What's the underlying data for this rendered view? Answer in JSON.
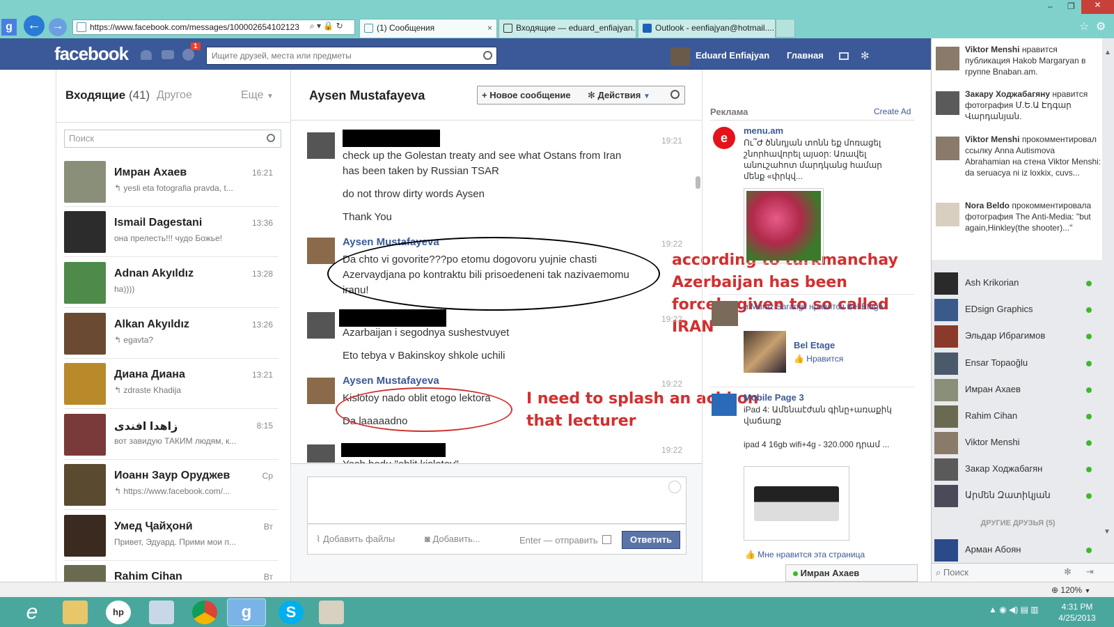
{
  "browser": {
    "url": "https://www.facebook.com/messages/100002654102123",
    "tabs": [
      "(1) Сообщения",
      "Входящие — eduard_enfiajyan...",
      "Outlook - eenfiajyan@hotmail...."
    ]
  },
  "fb": {
    "logo": "facebook",
    "notif_count": "1",
    "search_placeholder": "Ищите друзей, места или предметы",
    "user_name": "Eduard Enfiajyan",
    "home": "Главная"
  },
  "inbox": {
    "title": "Входящие",
    "count": "(41)",
    "other": "Другое",
    "more": "Еще",
    "search_placeholder": "Поиск",
    "threads": [
      {
        "name": "Имран Ахаев",
        "time": "16:21",
        "preview": "↰ yesli eta fotografia pravda, t...",
        "color": "#8a8f7a"
      },
      {
        "name": "Ismail Dagestani",
        "time": "13:36",
        "preview": "она прелесть!!! чудо Божье!",
        "color": "#2c2c2c"
      },
      {
        "name": "Adnan Akyıldız",
        "time": "13:28",
        "preview": "ha))))",
        "color": "#4e8a4a"
      },
      {
        "name": "Alkan Akyıldız",
        "time": "13:26",
        "preview": "↰ egavta?",
        "color": "#6b4a33"
      },
      {
        "name": "Диана Диана",
        "time": "13:21",
        "preview": "↰ zdraste Khadija",
        "color": "#b88a2a"
      },
      {
        "name": "زاهدا افندی",
        "time": "8:15",
        "preview": "вот завидую ТАКИМ людям, к...",
        "color": "#7a3a3a"
      },
      {
        "name": "Иоанн Заур Оруджев",
        "time": "Ср",
        "preview": "↰ https://www.facebook.com/...",
        "color": "#5a4a30"
      },
      {
        "name": "Умед Ҷайҳонӣ",
        "time": "Вт",
        "preview": "Привет, Эдуард. Прими мои п...",
        "color": "#3a2a20"
      },
      {
        "name": "Rahim Cihan",
        "time": "Вт",
        "preview": "",
        "color": "#6a6a50"
      }
    ]
  },
  "conversation": {
    "title": "Aysen Mustafayeva",
    "new_message": "+ Новое сообщение",
    "actions": "Действия",
    "messages": [
      {
        "sender": "",
        "time": "19:21",
        "lines": [
          "check up the Golestan treaty and see what Ostans from Iran",
          "has been taken by Russian TSAR",
          "do not throw dirty words Aysen",
          "Thank You"
        ]
      },
      {
        "sender": "Aysen Mustafayeva",
        "time": "19:22",
        "lines": [
          "Da chto vi govorite???po etomu dogovoru yujnie chasti",
          "Azervaydjana po kontraktu bili prisoedeneni tak nazivaemomu",
          "iranu!"
        ]
      },
      {
        "sender": "",
        "time": "19:22",
        "lines": [
          "Azarbaijan i segodnya sushestvuyet",
          "Eto tebya v Bakinskoy shkole uchili"
        ]
      },
      {
        "sender": "Aysen Mustafayeva",
        "time": "19:22",
        "lines": [
          "Kislotoy nado oblit etogo lektora",
          "Da laaaaadno"
        ]
      },
      {
        "sender": "",
        "time": "19:22",
        "lines": [
          "Yesh bodu \"oblit kislotoy\""
        ]
      }
    ],
    "annotation1": "according to turkmanchay Azerbaijan has been forcely given to so called IRAN",
    "annotation2": "I need to splash an acid on that lecturer",
    "composer": {
      "attach": "Добавить файлы",
      "add_photo": "Добавить...",
      "enter_send": "Enter — отправить",
      "reply": "Ответить"
    }
  },
  "ads": {
    "title": "Реклама",
    "create": "Create Ad",
    "items": [
      {
        "name": "menu.am",
        "text": "Ու՞Ժ ծննդյան տոնն եք մոռացել շնորհավորել այսօր: Առավել անուշահոտ մարդկանց համար մենք «փրկվ..."
      },
      {
        "name": "Bel Etage",
        "like": "Нравится",
        "friends_text": "и Muraz Sarangil нравится Bel Etage."
      },
      {
        "name": "Mobile Page 3",
        "text": "iPad 4: Ամենաէժան գինը+առաքիկ վաճառք",
        "text2": "ipad 4 16gb wifi+4g - 320.000 դրամ ..."
      }
    ],
    "like_page": "Мне нравится эта страница"
  },
  "chat": {
    "stories": [
      {
        "name": "Viktor Menshi",
        "text": "нравится публикация Hakob Margaryan в группе Bnaban.am."
      },
      {
        "name": "Закару Ходжабагяну",
        "text": "нравится фотография Մ.Ե.Ա Էդգար Վարդանյան."
      },
      {
        "name": "Viktor Menshi",
        "text": "прокомментировал ссылку Anna Autismova Abrahamian на стена Viktor Menshi: da seruacya ni iz loxkix, cuvs..."
      },
      {
        "name": "Nora Beldo",
        "text": "прокомментировала фотография The Anti-Media: \"but again,Hinkley(the shooter)...\""
      }
    ],
    "friends": [
      "Ash Krikorian",
      "EDsign Graphics",
      "Эльдар Ибрагимов",
      "Ensar Topaoğlu",
      "Имран Ахаев",
      "Rahim Cihan",
      "Viktor Menshi",
      "Закар Ходжабагян",
      "Արմեն Զատիկյան"
    ],
    "other_friends": "ДРУГИЕ ДРУЗЬЯ (5)",
    "other_friend": "Арман Абоян",
    "search": "Поиск",
    "open_chat": "Имран Ахаев"
  },
  "status": {
    "zoom": "120%"
  },
  "taskbar": {
    "time": "4:31 PM",
    "date": "4/25/2013"
  }
}
